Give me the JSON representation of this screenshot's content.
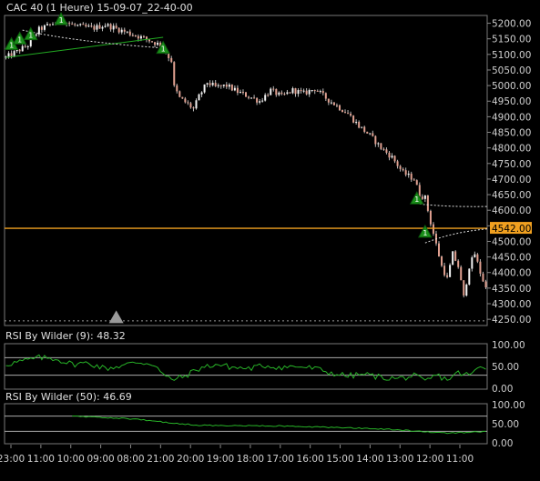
{
  "chart_data": [
    {
      "type": "candlestick",
      "title": "CAC 40 (1 Heure) 15-09-07_22-40-00",
      "ylim": [
        4230,
        5225
      ],
      "y_ticks": [
        "5200.00",
        "5150.00",
        "5100.00",
        "5050.00",
        "5000.00",
        "4950.00",
        "4900.00",
        "4850.00",
        "4800.00",
        "4750.00",
        "4700.00",
        "4650.00",
        "4600.00",
        "4550.00",
        "4500.00",
        "4450.00",
        "4400.00",
        "4350.00",
        "4300.00",
        "4250.00"
      ],
      "y_tick_values": [
        5200,
        5150,
        5100,
        5050,
        5000,
        4950,
        4900,
        4850,
        4800,
        4750,
        4700,
        4650,
        4600,
        4550,
        4500,
        4450,
        4400,
        4350,
        4300,
        4250
      ],
      "last_price": {
        "label": "4542.00",
        "value": 4542,
        "color": "#f0a020"
      },
      "colors": {
        "up": "#f4f4f4",
        "down": "#e0a090",
        "wick": "#bbbbbb",
        "trend": "#22aa22",
        "signal": "#1a8f1a"
      },
      "x_ticks": [
        "23:00",
        "11:00",
        "10:00",
        "09:00",
        "08:00",
        "21:00",
        "20:00",
        "19:00",
        "18:00",
        "17:00",
        "16:00",
        "15:00",
        "14:00",
        "13:00",
        "12:00",
        "11:00"
      ],
      "anchor_path": [
        [
          0,
          5090
        ],
        [
          4,
          5110
        ],
        [
          8,
          5130
        ],
        [
          12,
          5180
        ],
        [
          16,
          5195
        ],
        [
          20,
          5210
        ],
        [
          24,
          5195
        ],
        [
          28,
          5188
        ],
        [
          32,
          5185
        ],
        [
          36,
          5195
        ],
        [
          40,
          5183
        ],
        [
          44,
          5170
        ],
        [
          48,
          5158
        ],
        [
          52,
          5145
        ],
        [
          56,
          5130
        ],
        [
          58,
          5105
        ],
        [
          60,
          5080
        ],
        [
          61,
          4995
        ],
        [
          63,
          4960
        ],
        [
          66,
          4940
        ],
        [
          68,
          4925
        ],
        [
          70,
          4965
        ],
        [
          73,
          5010
        ],
        [
          76,
          4995
        ],
        [
          80,
          5000
        ],
        [
          84,
          4980
        ],
        [
          88,
          4965
        ],
        [
          92,
          4950
        ],
        [
          96,
          4985
        ],
        [
          100,
          4965
        ],
        [
          104,
          4985
        ],
        [
          108,
          4975
        ],
        [
          112,
          4990
        ],
        [
          116,
          4960
        ],
        [
          120,
          4935
        ],
        [
          124,
          4910
        ],
        [
          128,
          4870
        ],
        [
          132,
          4840
        ],
        [
          136,
          4800
        ],
        [
          140,
          4770
        ],
        [
          144,
          4720
        ],
        [
          148,
          4700
        ],
        [
          150,
          4650
        ],
        [
          152,
          4640
        ],
        [
          154,
          4560
        ],
        [
          156,
          4490
        ],
        [
          158,
          4420
        ],
        [
          160,
          4380
        ],
        [
          162,
          4460
        ],
        [
          164,
          4420
        ],
        [
          166,
          4320
        ],
        [
          168,
          4420
        ],
        [
          170,
          4460
        ],
        [
          172,
          4400
        ],
        [
          174,
          4350
        ]
      ],
      "annotations": {
        "signals": [
          {
            "label": "1",
            "bar": 2,
            "value": 5130
          },
          {
            "label": "1",
            "bar": 5,
            "value": 5148
          },
          {
            "label": "1",
            "bar": 9,
            "value": 5162
          },
          {
            "label": "1",
            "bar": 20,
            "value": 5210
          },
          {
            "label": "1",
            "bar": 57,
            "value": 5118
          },
          {
            "label": "1",
            "bar": 149,
            "value": 4635
          },
          {
            "label": "1",
            "bar": 152,
            "value": 4528
          }
        ],
        "gray_marker": {
          "bar": 40,
          "value": 4255
        }
      }
    },
    {
      "type": "line",
      "title": "RSI By Wilder (9): 48.32",
      "ylim": [
        0,
        100
      ],
      "y_ticks": [
        "100.00",
        "50.00",
        "0.00"
      ],
      "y_tick_values": [
        100,
        50,
        0
      ],
      "levels": [
        70,
        30
      ],
      "anchor_path": [
        [
          0,
          55
        ],
        [
          6,
          62
        ],
        [
          12,
          70
        ],
        [
          18,
          68
        ],
        [
          24,
          55
        ],
        [
          30,
          58
        ],
        [
          36,
          45
        ],
        [
          42,
          52
        ],
        [
          48,
          60
        ],
        [
          54,
          55
        ],
        [
          57,
          30
        ],
        [
          60,
          20
        ],
        [
          64,
          25
        ],
        [
          70,
          45
        ],
        [
          76,
          55
        ],
        [
          82,
          48
        ],
        [
          88,
          45
        ],
        [
          94,
          52
        ],
        [
          100,
          48
        ],
        [
          106,
          50
        ],
        [
          112,
          45
        ],
        [
          118,
          35
        ],
        [
          124,
          28
        ],
        [
          130,
          32
        ],
        [
          136,
          25
        ],
        [
          142,
          22
        ],
        [
          148,
          28
        ],
        [
          152,
          15
        ],
        [
          156,
          30
        ],
        [
          160,
          20
        ],
        [
          164,
          35
        ],
        [
          168,
          30
        ],
        [
          172,
          48
        ],
        [
          174,
          48
        ]
      ]
    },
    {
      "type": "line",
      "title": "RSI By Wilder (50): 46.69",
      "ylim": [
        0,
        100
      ],
      "y_ticks": [
        "100.00",
        "50.00",
        "0.00"
      ],
      "y_tick_values": [
        100,
        50,
        0
      ],
      "levels": [
        70,
        30
      ],
      "anchor_path": [
        [
          24,
          70
        ],
        [
          40,
          65
        ],
        [
          50,
          60
        ],
        [
          60,
          52
        ],
        [
          70,
          46
        ],
        [
          80,
          45
        ],
        [
          100,
          44
        ],
        [
          120,
          40
        ],
        [
          140,
          35
        ],
        [
          150,
          30
        ],
        [
          160,
          25
        ],
        [
          170,
          28
        ],
        [
          174,
          30
        ]
      ]
    }
  ]
}
